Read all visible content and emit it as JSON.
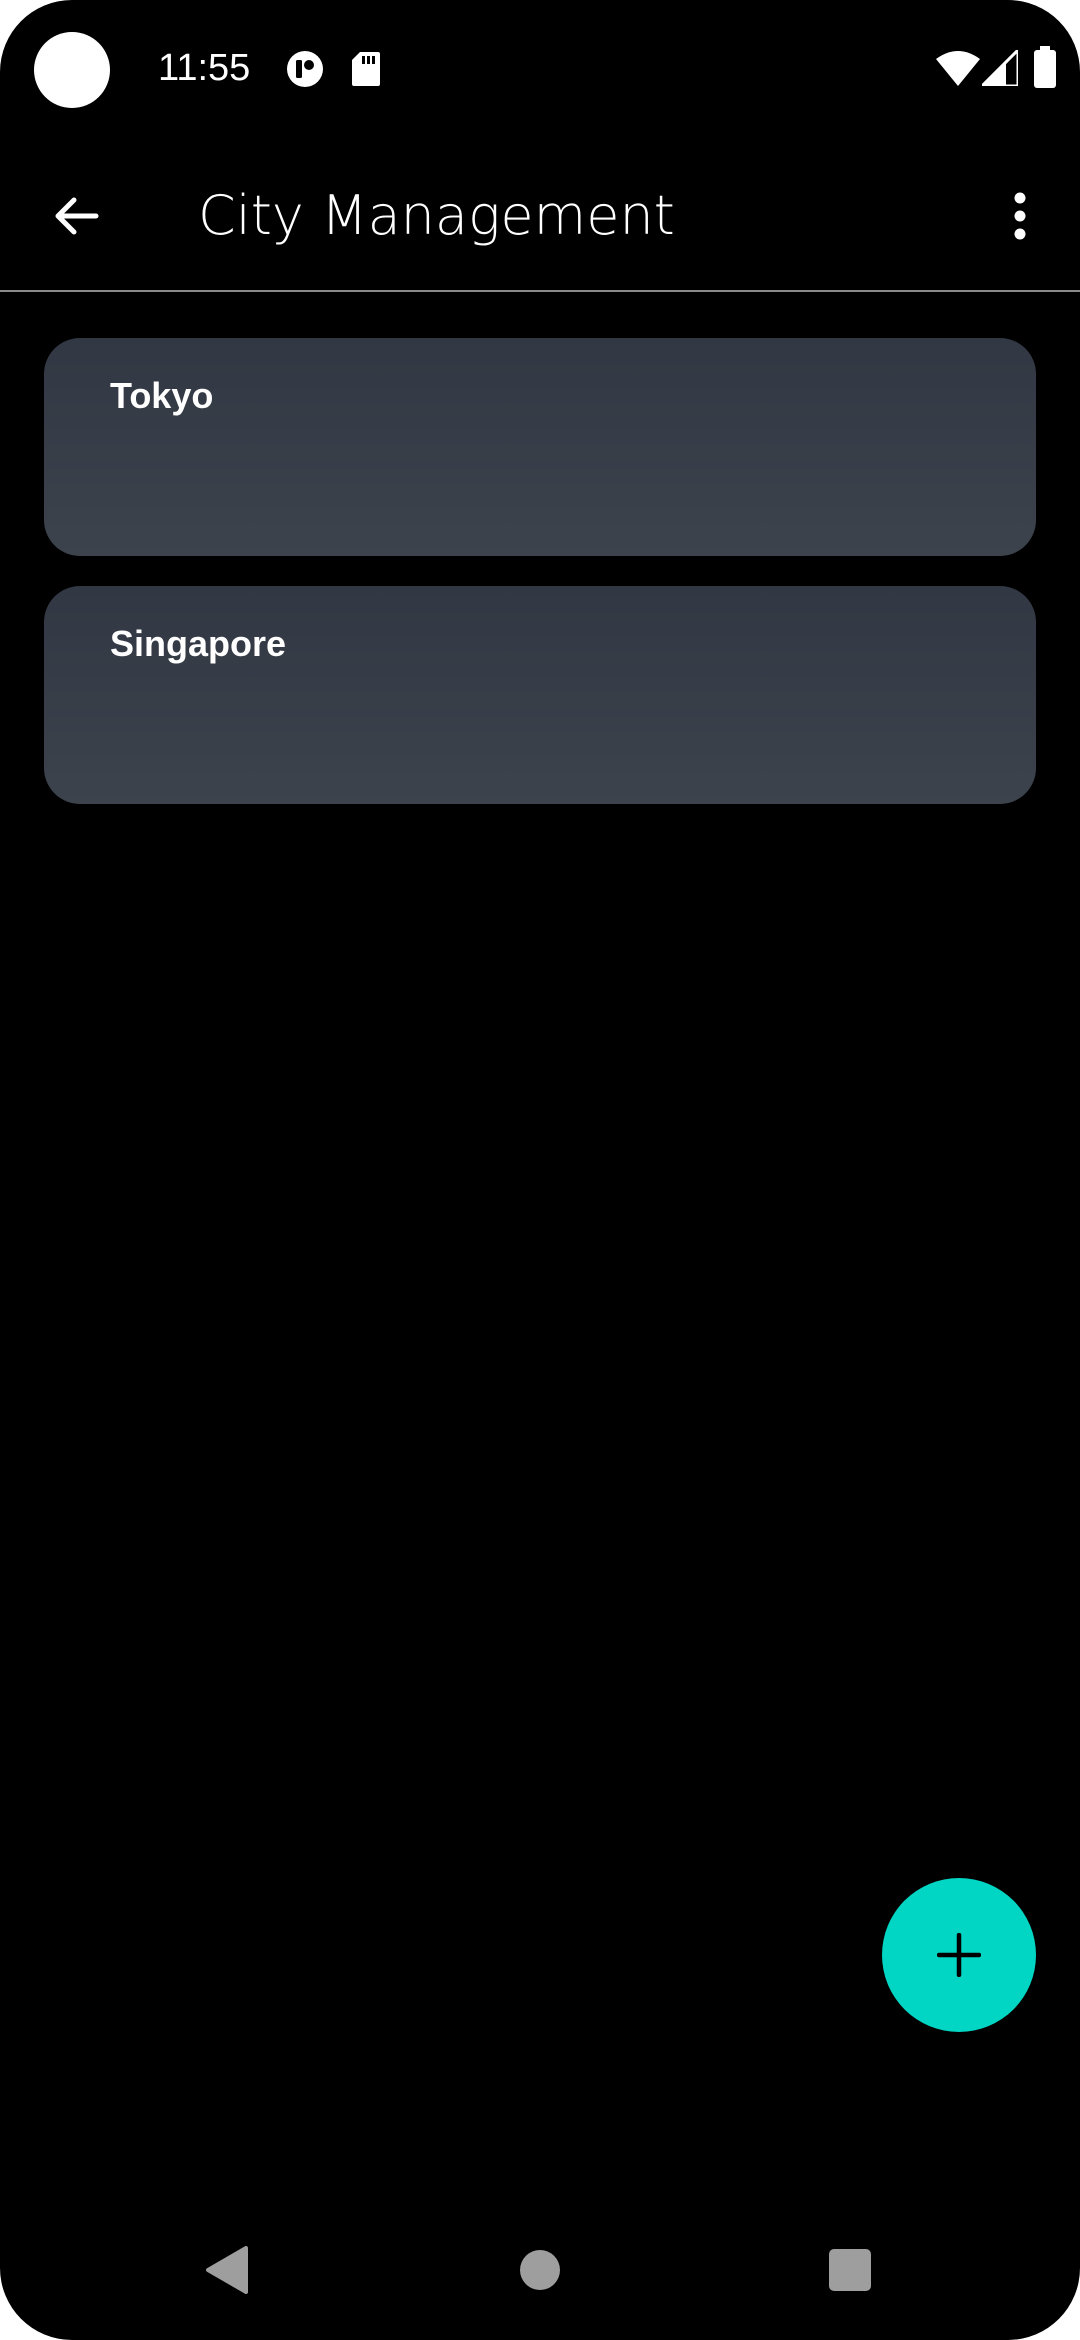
{
  "status_bar": {
    "time": "11:55",
    "icons": [
      "camera-cutout",
      "app-notification-icon",
      "sd-card-icon",
      "wifi-icon",
      "signal-icon",
      "battery-icon"
    ]
  },
  "app_bar": {
    "title": "City Management",
    "back_icon": "arrow-back-icon",
    "menu_icon": "more-vert-icon"
  },
  "cities": [
    {
      "name": "Tokyo"
    },
    {
      "name": "Singapore"
    }
  ],
  "fab": {
    "icon": "plus-icon",
    "color": "#00d6c3"
  },
  "nav_bar": {
    "icons": [
      "nav-back-icon",
      "nav-home-icon",
      "nav-recents-icon"
    ]
  },
  "colors": {
    "background": "#000000",
    "card": "#363c46",
    "accent": "#00d6c3",
    "text": "#ffffff",
    "nav_icon": "#9e9e9e"
  }
}
